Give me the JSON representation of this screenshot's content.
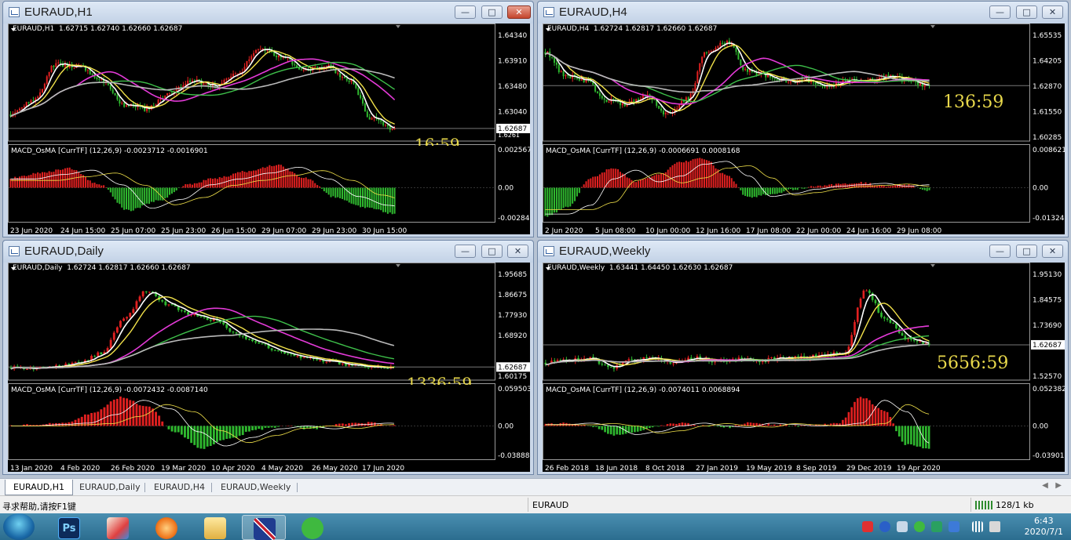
{
  "windows": [
    {
      "id": "h1",
      "title": "EURAUD,H1",
      "info": "EURAUD,H1  1.62715 1.62740 1.62660 1.62687",
      "prices": [
        "1.64340",
        "1.63910",
        "1.63480",
        "1.63040",
        "1.62687"
      ],
      "price_cut": "1.6261",
      "current_price": "1.62687",
      "timer": "16:59",
      "macd_label": "MACD_OsMA [CurrTF] (12,26,9) -0.0023712 -0.0016901",
      "macd_scale": [
        "0.0025671",
        "0.00",
        "-0.002849"
      ],
      "dates": [
        "23 Jun 2020",
        "24 Jun 15:00",
        "25 Jun 07:00",
        "25 Jun 23:00",
        "26 Jun 15:00",
        "29 Jun 07:00",
        "29 Jun 23:00",
        "30 Jun 15:00"
      ]
    },
    {
      "id": "h4",
      "title": "EURAUD,H4",
      "info": "EURAUD,H4  1.62724 1.62817 1.62660 1.62687",
      "prices": [
        "1.65535",
        "1.64205",
        "1.62870",
        "1.61550",
        "1.60285"
      ],
      "current_price": "1.62687",
      "timer": "136:59",
      "macd_label": "MACD_OsMA [CurrTF] (12,26,9) -0.0006691 0.0008168",
      "macd_scale": [
        "0.008621",
        "0.00",
        "-0.013246"
      ],
      "dates": [
        "2 Jun 2020",
        "5 Jun 08:00",
        "10 Jun 00:00",
        "12 Jun 16:00",
        "17 Jun 08:00",
        "22 Jun 00:00",
        "24 Jun 16:00",
        "29 Jun 08:00"
      ]
    },
    {
      "id": "daily",
      "title": "EURAUD,Daily",
      "info": "EURAUD,Daily  1.62724 1.62817 1.62660 1.62687",
      "prices": [
        "1.95685",
        "1.86675",
        "1.77930",
        "1.68920",
        "1.62687",
        "1.60175"
      ],
      "current_price": "1.62687",
      "timer": "1336:59",
      "macd_label": "MACD_OsMA [CurrTF] (12,26,9) -0.0072432 -0.0087140",
      "macd_scale": [
        "0.0595038",
        "0.00",
        "-0.038889"
      ],
      "dates": [
        "13 Jan 2020",
        "4 Feb 2020",
        "26 Feb 2020",
        "19 Mar 2020",
        "10 Apr 2020",
        "4 May 2020",
        "26 May 2020",
        "17 Jun 2020"
      ]
    },
    {
      "id": "weekly",
      "title": "EURAUD,Weekly",
      "info": "EURAUD,Weekly  1.63441 1.64450 1.62630 1.62687",
      "prices": [
        "1.95130",
        "1.84575",
        "1.73690",
        "1.62687",
        "1.52570"
      ],
      "current_price": "1.62687",
      "timer": "5656:59",
      "macd_label": "MACD_OsMA [CurrTF] (12,26,9) -0.0074011 0.0068894",
      "macd_scale": [
        "0.0523829",
        "0.00",
        "-0.039012"
      ],
      "dates": [
        "26 Feb 2018",
        "18 Jun 2018",
        "8 Oct 2018",
        "27 Jan 2019",
        "19 May 2019",
        "8 Sep 2019",
        "29 Dec 2019",
        "19 Apr 2020"
      ]
    }
  ],
  "window_controls": {
    "minimize": "—",
    "maximize": "□",
    "close": "✕"
  },
  "tabs": [
    "EURAUD,H1",
    "EURAUD,Daily",
    "EURAUD,H4",
    "EURAUD,Weekly"
  ],
  "status": {
    "help": "寻求帮助,请按F1键",
    "symbol": "EURAUD",
    "traffic": "128/1 kb"
  },
  "taskbar": {
    "apps": [
      "Ps"
    ],
    "time": "6:43",
    "date": "2020/7/1"
  },
  "colors": {
    "bull": "#e02020",
    "bear": "#2fb82f",
    "ma_white": "#ffffff",
    "ma_yellow": "#f2e24a",
    "ma_magenta": "#e43ad8",
    "ma_green": "#3ec04a",
    "ma_gray": "#b9b9b9",
    "timer": "#e8d84b"
  }
}
